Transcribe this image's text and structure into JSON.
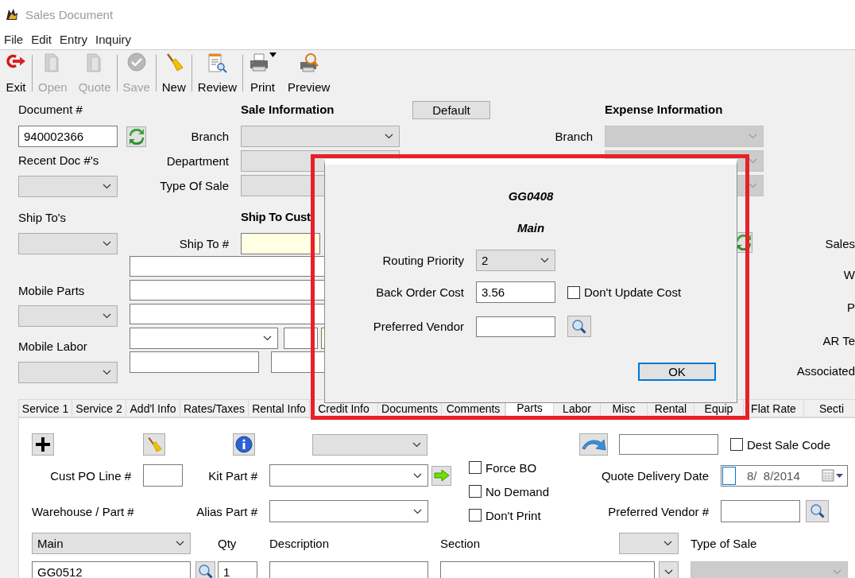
{
  "window": {
    "title": "Sales Document"
  },
  "menu": [
    "File",
    "Edit",
    "Entry",
    "Inquiry"
  ],
  "toolbar": [
    [
      {
        "label": "Exit",
        "disabled": false,
        "has_menu": false
      }
    ],
    [
      {
        "label": "Open",
        "disabled": true,
        "has_menu": false
      },
      {
        "label": "Quote",
        "disabled": true,
        "has_menu": false
      }
    ],
    [
      {
        "label": "Save",
        "disabled": true,
        "has_menu": false
      }
    ],
    [
      {
        "label": "New",
        "disabled": false,
        "has_menu": false
      }
    ],
    [
      {
        "label": "Review",
        "disabled": false,
        "has_menu": false
      }
    ],
    [
      {
        "label": "Print",
        "disabled": false,
        "has_menu": true
      },
      {
        "label": "Preview",
        "disabled": false,
        "has_menu": false
      }
    ]
  ],
  "document": {
    "label": "Document #",
    "value": "940002366",
    "recent_label": "Recent Doc #'s",
    "ship_tos_label": "Ship To's",
    "mobile_parts_label": "Mobile Parts",
    "mobile_labor_label": "Mobile Labor"
  },
  "sale_information": {
    "title": "Sale Information",
    "field_labels": [
      "Branch",
      "Department",
      "Type Of Sale"
    ]
  },
  "default_button": "Default",
  "expense_information": {
    "title": "Expense Information",
    "branch_label": "Branch"
  },
  "ship_to_customer": {
    "title": "Ship To Cust",
    "ship_to_label": "Ship To #"
  },
  "right_labels": [
    "Sales",
    "W",
    "P",
    "AR Te",
    "Associated"
  ],
  "tabs": [
    {
      "label": "Service 1",
      "selected": false
    },
    {
      "label": "Service 2",
      "selected": false
    },
    {
      "label": "Add'l Info",
      "selected": false
    },
    {
      "label": "Rates/Taxes",
      "selected": false
    },
    {
      "label": "Rental Info",
      "selected": false
    },
    {
      "label": "Credit Info",
      "selected": false
    },
    {
      "label": "Documents",
      "selected": false
    },
    {
      "label": "Comments",
      "selected": false
    },
    {
      "label": "Parts",
      "selected": true
    },
    {
      "label": "Labor",
      "selected": false
    },
    {
      "label": "Misc",
      "selected": false
    },
    {
      "label": "Rental",
      "selected": false
    },
    {
      "label": "Equip",
      "selected": false
    },
    {
      "label": "Flat Rate",
      "selected": false
    },
    {
      "label": "Secti",
      "selected": false
    }
  ],
  "parts": {
    "cust_po_line_label": "Cust PO Line #",
    "kit_part_label": "Kit Part #",
    "warehouse_part_label": "Warehouse / Part #",
    "alias_part_label": "Alias Part #",
    "checkboxes": [
      {
        "label": "Force BO",
        "checked": false
      },
      {
        "label": "No Demand",
        "checked": false
      },
      {
        "label": "Don't Print",
        "checked": false
      }
    ],
    "dest_sale_code": {
      "label": "Dest Sale Code",
      "checked": false
    },
    "quote_delivery_date": {
      "label": "Quote Delivery Date",
      "value": "8/  8/2014"
    },
    "preferred_vendor_label": "Preferred Vendor #",
    "warehouse": "Main",
    "qty_label": "Qty",
    "description_label": "Description",
    "section_label": "Section",
    "type_of_sale_label": "Type of Sale",
    "part_number": "GG0512",
    "qty": "1"
  },
  "dialog": {
    "heading": "GG0408",
    "subheading": "Main",
    "routing_priority": {
      "label": "Routing Priority",
      "value": "2"
    },
    "back_order_cost": {
      "label": "Back Order Cost",
      "value": "3.56"
    },
    "dont_update_cost": {
      "label": "Don't Update Cost",
      "checked": false
    },
    "preferred_vendor": {
      "label": "Preferred Vendor"
    },
    "ok": "OK"
  }
}
